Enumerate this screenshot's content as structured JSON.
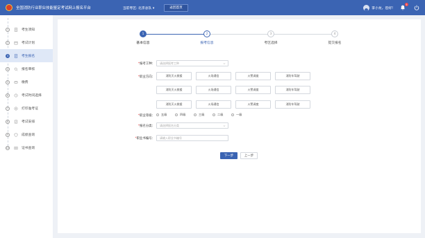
{
  "header": {
    "title": "全国消防行业职业技能鉴定考试网上报名平台",
    "exam_site": "当前考区: 北京总队 ▾",
    "back_label": "返回首页",
    "greeting": "李小龙，您好!",
    "notification_count": "5",
    "brand_color": "#3b64b3"
  },
  "sidebar": {
    "items": [
      {
        "num": "1",
        "icon": "document-icon",
        "label": "考生须知"
      },
      {
        "num": "2",
        "icon": "calendar-icon",
        "label": "考试计划"
      },
      {
        "num": "3",
        "icon": "form-icon",
        "label": "考生报名"
      },
      {
        "num": "4",
        "icon": "review-icon",
        "label": "报名审核"
      },
      {
        "num": "5",
        "icon": "fee-icon",
        "label": "缴费"
      },
      {
        "num": "6",
        "icon": "clock-icon",
        "label": "考试时间选择"
      },
      {
        "num": "7",
        "icon": "print-icon",
        "label": "打印准考证"
      },
      {
        "num": "8",
        "icon": "schedule-icon",
        "label": "考试安排"
      },
      {
        "num": "9",
        "icon": "score-icon",
        "label": "成绩查询"
      },
      {
        "num": "10",
        "icon": "certificate-icon",
        "label": "证书查询"
      }
    ],
    "active_index": 2
  },
  "steps": [
    {
      "num": "1",
      "label": "基本信息",
      "state": "done"
    },
    {
      "num": "2",
      "label": "报考信息",
      "state": "current"
    },
    {
      "num": "3",
      "label": "考区选择",
      "state": "todo"
    },
    {
      "num": "4",
      "label": "提交报名",
      "state": "todo"
    }
  ],
  "form": {
    "job_type_label": "报考工种：",
    "job_type_placeholder": "请选择报考工种",
    "direction_label": "职业方向：",
    "directions": [
      "消防灭火救援",
      "火场通信",
      "火警调度",
      "消防车驾驶",
      "消防灭火救援",
      "火场通信",
      "火警调度",
      "消防车驾驶",
      "消防灭火救援",
      "火场通信",
      "火警调度",
      "消防车驾驶"
    ],
    "level_label": "职业等级：",
    "levels": [
      "五级",
      "四级",
      "三级",
      "二级",
      "一级"
    ],
    "apply_type_label": "报名分类：",
    "apply_type_placeholder": "请选择报名分类",
    "cert_label": "职业书编号：",
    "cert_placeholder": "请输入职业书编号",
    "next_label": "下一步",
    "prev_label": "上一步"
  }
}
